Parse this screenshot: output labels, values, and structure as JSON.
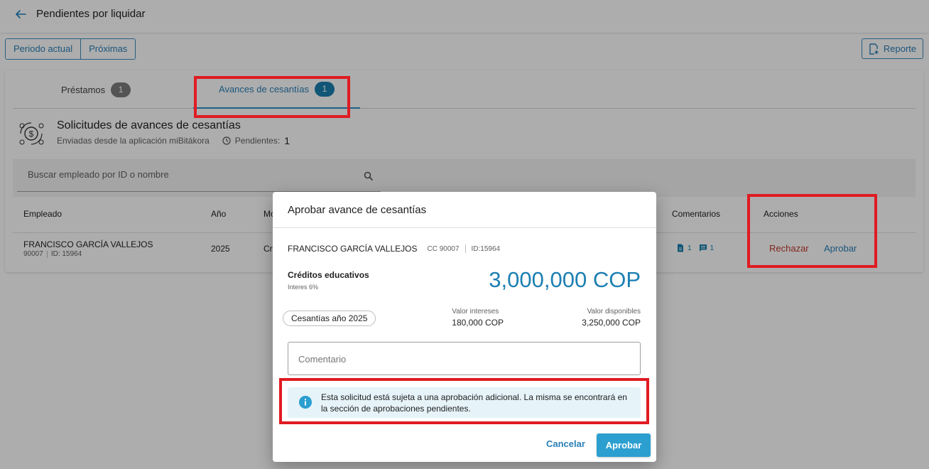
{
  "header": {
    "title": "Pendientes por liquidar"
  },
  "period": {
    "current_label": "Periodo actual",
    "next_label": "Próximas"
  },
  "report": {
    "label": "Reporte"
  },
  "tabs": [
    {
      "label": "Préstamos",
      "count": "1"
    },
    {
      "label": "Avances de cesantías",
      "count": "1"
    }
  ],
  "section": {
    "title": "Solicitudes de avances de cesantías",
    "subtitle": "Enviadas desde la aplicación miBitákora",
    "pending_label": "Pendientes:",
    "pending_count": "1"
  },
  "search": {
    "placeholder": "Buscar empleado por ID o nombre"
  },
  "table": {
    "headers": {
      "employee": "Empleado",
      "year": "Año",
      "mo": "Mo",
      "comments": "Comentarios",
      "actions": "Acciones"
    },
    "rows": [
      {
        "name": "FRANCISCO GARCÍA VALLEJOS",
        "code": "90007",
        "id": "ID: 15964",
        "year": "2025",
        "concept_trunc": "Cre",
        "doc_count": "1",
        "comment_count": "1",
        "reject_label": "Rechazar",
        "approve_label": "Aprobar"
      }
    ]
  },
  "dialog": {
    "title": "Aprobar avance de cesantías",
    "employee_name": "FRANCISCO GARCÍA VALLEJOS",
    "employee_cc": "CC 90007",
    "employee_id": "ID:15964",
    "credit_type": "Créditos educativos",
    "interest": "Interes 6%",
    "amount": "3,000,000 COP",
    "chip": "Cesantías año 2025",
    "interest_value_label": "Valor intereses",
    "interest_value": "180,000 COP",
    "available_label": "Valor disponibles",
    "available_value": "3,250,000 COP",
    "comment_placeholder": "Comentario",
    "info": "Esta solicitud está sujeta a una aprobación adicional. La misma se encontrará en la sección de aprobaciones pendientes.",
    "cancel_label": "Cancelar",
    "approve_label": "Aprobar"
  },
  "colors": {
    "accent": "#2a7fb6",
    "reject": "#c0392b",
    "highlight": "#e01b22",
    "primary_button": "#2b9fd0"
  }
}
